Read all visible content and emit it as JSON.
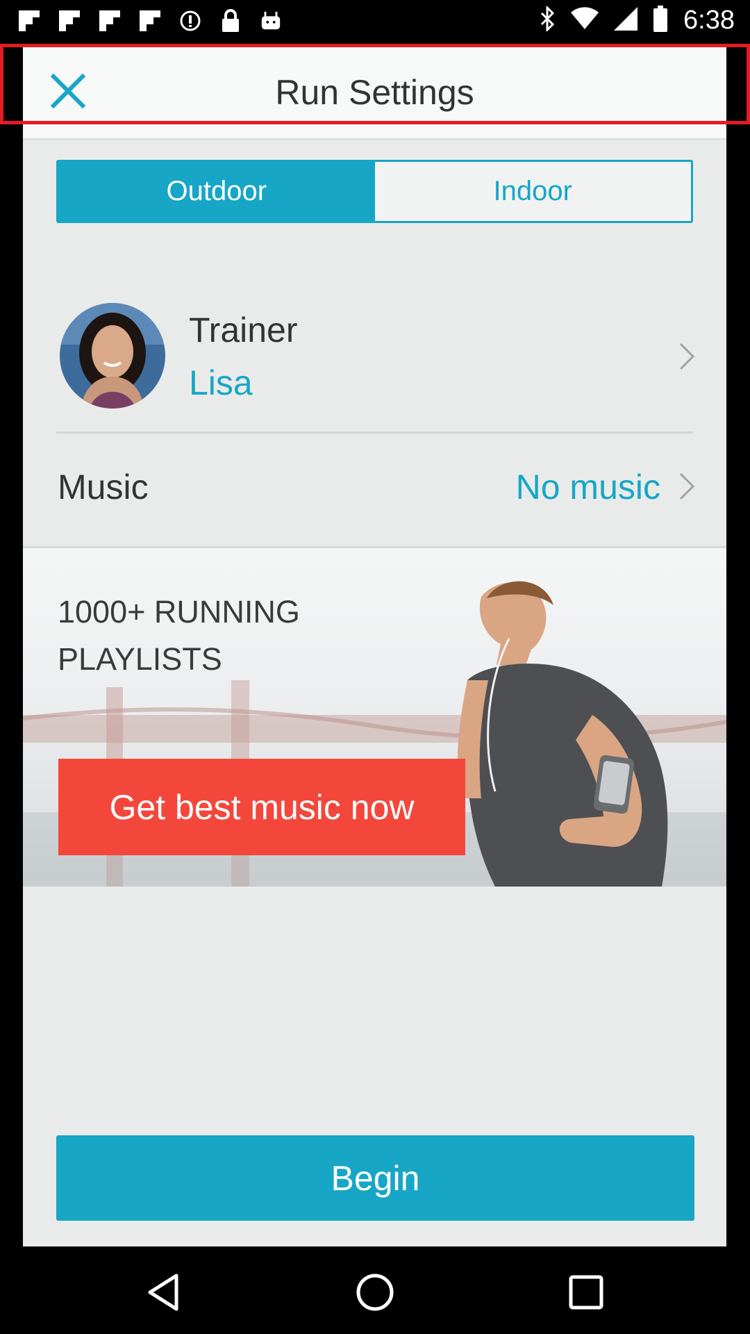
{
  "status_bar": {
    "time": "6:38",
    "icons": [
      "flipboard-icon",
      "flipboard-icon",
      "flipboard-icon",
      "flipboard-icon",
      "info-icon",
      "lock-icon",
      "android-icon",
      "bluetooth-icon",
      "wifi-icon",
      "signal-icon",
      "battery-icon"
    ]
  },
  "header": {
    "title": "Run Settings",
    "close_icon": "close-icon"
  },
  "mode_toggle": {
    "options": [
      "Outdoor",
      "Indoor"
    ],
    "selected": "Outdoor"
  },
  "trainer": {
    "label": "Trainer",
    "name": "Lisa"
  },
  "music": {
    "label": "Music",
    "value": "No music"
  },
  "promo": {
    "title": "1000+ RUNNING PLAYLISTS",
    "button_label": "Get best music now"
  },
  "begin_label": "Begin",
  "colors": {
    "accent": "#17a6c6",
    "promo_button": "#f4473b",
    "highlight_box": "#e31c23"
  },
  "nav_bar": {
    "icons": [
      "back-icon",
      "home-icon",
      "recents-icon"
    ]
  }
}
